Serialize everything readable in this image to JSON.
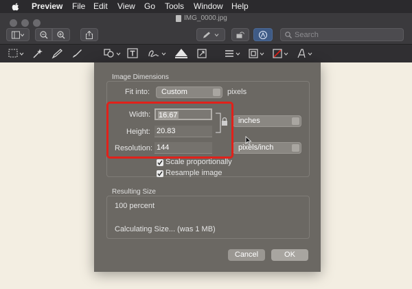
{
  "menubar": {
    "app": "Preview",
    "items": [
      "File",
      "Edit",
      "View",
      "Go",
      "Tools",
      "Window",
      "Help"
    ]
  },
  "toolbar": {
    "doc_title": "IMG_0000.jpg",
    "search_placeholder": "Search"
  },
  "dialog": {
    "image_dimensions_title": "Image Dimensions",
    "fit_into_label": "Fit into:",
    "fit_into_value": "Custom",
    "fit_into_unit": "pixels",
    "width_label": "Width:",
    "width_value": "16.67",
    "height_label": "Height:",
    "height_value": "20.83",
    "resolution_label": "Resolution:",
    "resolution_value": "144",
    "size_unit": "inches",
    "resolution_unit": "pixels/inch",
    "scale_proportionally": "Scale proportionally",
    "resample_image": "Resample image",
    "resulting_size_title": "Resulting Size",
    "percent_text": "100 percent",
    "calculating_text": "Calculating Size... (was 1 MB)",
    "cancel_label": "Cancel",
    "ok_label": "OK"
  },
  "colors": {
    "highlight": "#e1211a",
    "dialog_bg": "#6b6863",
    "canvas_bg": "#f3eee2"
  }
}
